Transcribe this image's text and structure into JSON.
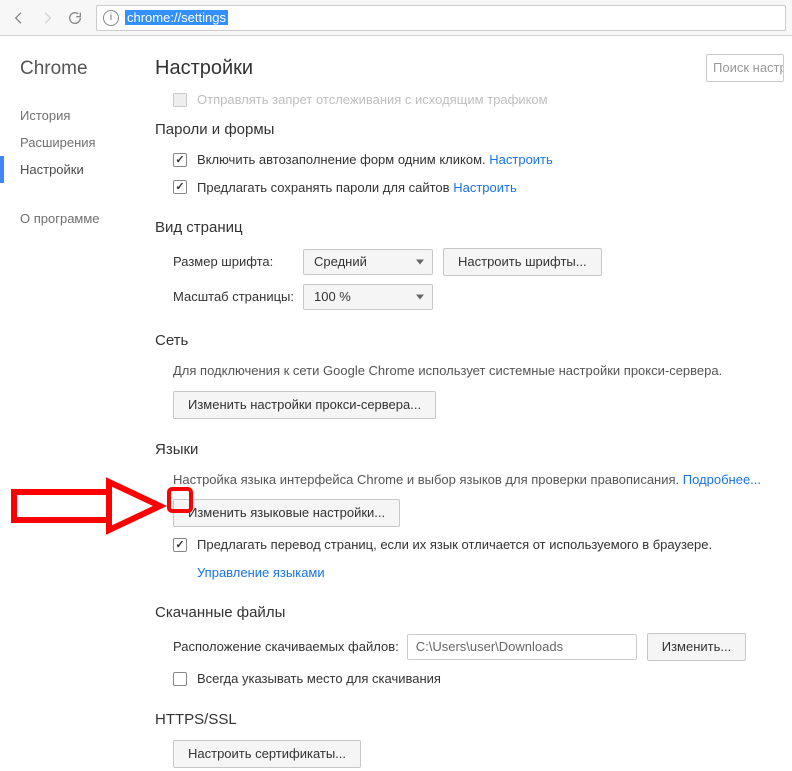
{
  "toolbar": {
    "url_selected": "chrome://settings"
  },
  "sidebar": {
    "title": "Chrome",
    "items": [
      {
        "label": "История",
        "active": false
      },
      {
        "label": "Расширения",
        "active": false
      },
      {
        "label": "Настройки",
        "active": true
      },
      {
        "label": "О программе",
        "active": false
      }
    ]
  },
  "page": {
    "title": "Настройки",
    "search_placeholder": "Поиск настро"
  },
  "faded": {
    "label": "Отправлять запрет отслеживания с исходящим трафиком"
  },
  "passwords": {
    "title": "Пароли и формы",
    "autofill": "Включить автозаполнение форм одним кликом.",
    "autofill_link": "Настроить",
    "save_pw": "Предлагать сохранять пароли для сайтов",
    "save_pw_link": "Настроить"
  },
  "appearance": {
    "title": "Вид страниц",
    "font_label": "Размер шрифта:",
    "font_value": "Средний",
    "font_btn": "Настроить шрифты...",
    "zoom_label": "Масштаб страницы:",
    "zoom_value": "100 %"
  },
  "network": {
    "title": "Сеть",
    "desc": "Для подключения к сети Google Chrome использует системные настройки прокси-сервера.",
    "btn": "Изменить настройки прокси-сервера..."
  },
  "languages": {
    "title": "Языки",
    "desc": "Настройка языка интерфейса Chrome и выбор языков для проверки правописания.",
    "more_link": "Подробнее...",
    "btn": "Изменить языковые настройки...",
    "translate": "Предлагать перевод страниц, если их язык отличается от используемого в браузере.",
    "manage_link": "Управление языками"
  },
  "downloads": {
    "title": "Скачанные файлы",
    "loc_label": "Расположение скачиваемых файлов:",
    "loc_value": "C:\\Users\\user\\Downloads",
    "change_btn": "Изменить...",
    "ask": "Всегда указывать место для скачивания"
  },
  "https": {
    "title": "HTTPS/SSL",
    "btn": "Настроить сертификаты..."
  }
}
